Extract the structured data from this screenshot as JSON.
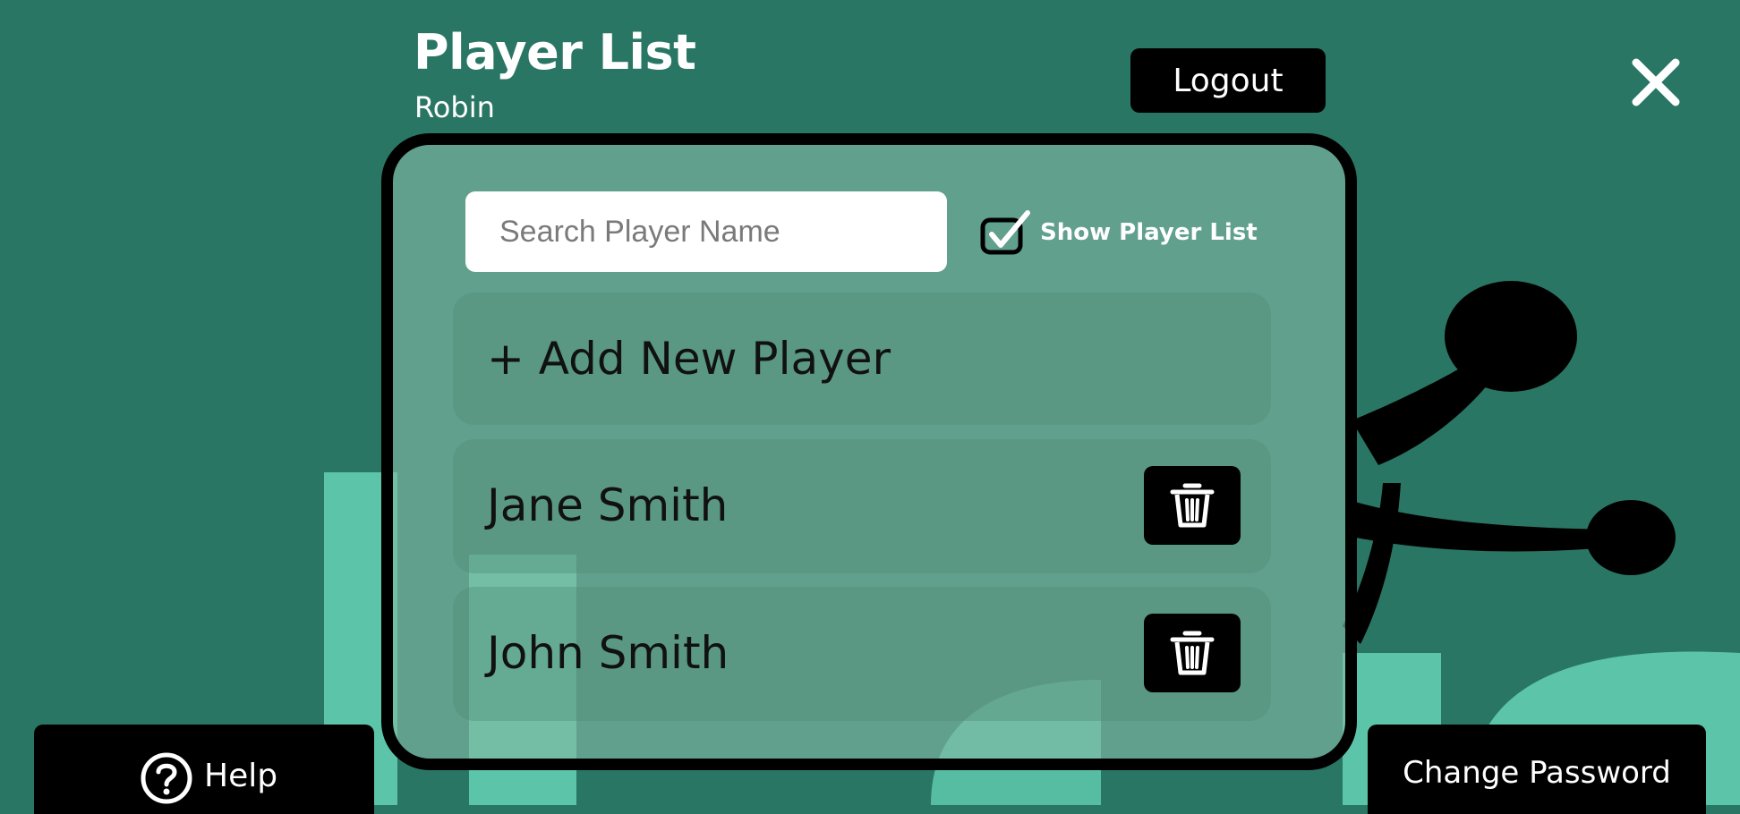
{
  "header": {
    "title": "Player List",
    "username": "Robin",
    "logout_label": "Logout",
    "close_icon": "close-icon"
  },
  "search": {
    "placeholder": "Search Player Name",
    "value": ""
  },
  "show_player_list": {
    "label": "Show Player List",
    "checked": true
  },
  "add_player": {
    "label": "+ Add New Player"
  },
  "players": [
    {
      "name": "Jane Smith",
      "action_icon": "trash-icon"
    },
    {
      "name": "John Smith",
      "action_icon": "trash-icon"
    }
  ],
  "footer": {
    "help_label": "Help",
    "help_icon": "question-circle-icon",
    "change_password_label": "Change Password"
  },
  "colors": {
    "background": "#2a7664",
    "accent_light": "#5cc5a9",
    "panel": "#82b9a5",
    "button": "#000000",
    "text_light": "#ffffff"
  }
}
